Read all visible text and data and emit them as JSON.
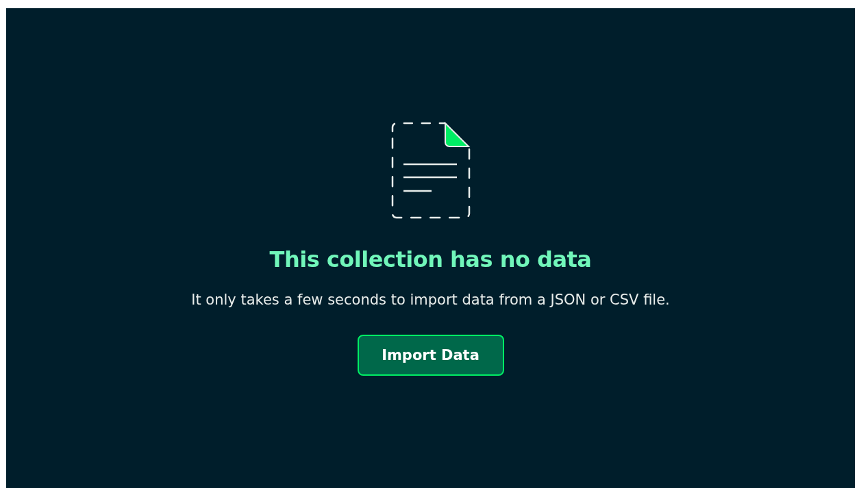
{
  "empty_state": {
    "title": "This collection has no data",
    "message": "It only takes a few seconds to import data from a JSON or CSV file.",
    "button": "Import Data"
  }
}
